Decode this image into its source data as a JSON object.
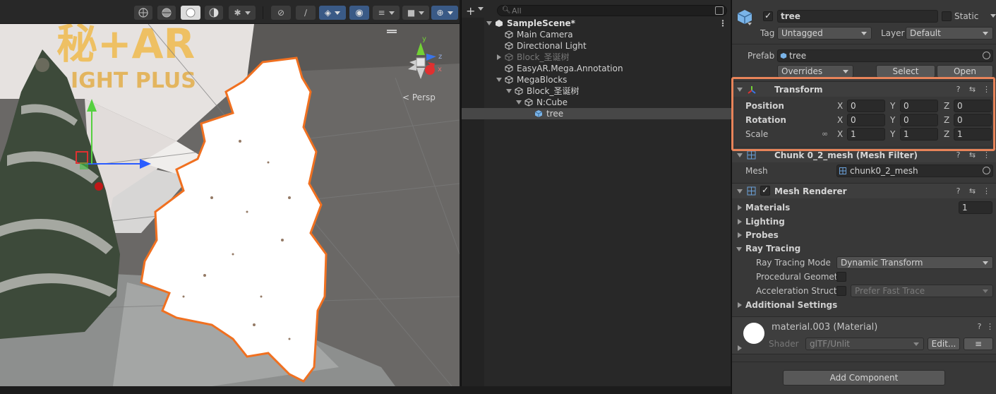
{
  "scene_view": {
    "persp_label": "< Persp",
    "billboard_text_top": "秘+AR",
    "billboard_text_bottom": "IGHT PLUS"
  },
  "hierarchy": {
    "search_placeholder": "All",
    "items": [
      {
        "label": "SampleScene*"
      },
      {
        "label": "Main Camera"
      },
      {
        "label": "Directional Light"
      },
      {
        "label": "Block_圣诞树"
      },
      {
        "label": "EasyAR.Mega.Annotation"
      },
      {
        "label": "MegaBlocks"
      },
      {
        "label": "Block_圣诞树"
      },
      {
        "label": "N:Cube"
      },
      {
        "label": "tree"
      }
    ]
  },
  "inspector": {
    "object_name": "tree",
    "static_label": "Static",
    "tag_label": "Tag",
    "tag_value": "Untagged",
    "layer_label": "Layer",
    "layer_value": "Default",
    "prefab_label": "Prefab",
    "prefab_value": "tree",
    "overrides_label": "Overrides",
    "select_label": "Select",
    "open_label": "Open",
    "transform": {
      "title": "Transform",
      "position_label": "Position",
      "rotation_label": "Rotation",
      "scale_label": "Scale",
      "position": {
        "x": "0",
        "y": "0",
        "z": "0"
      },
      "rotation": {
        "x": "0",
        "y": "0",
        "z": "0"
      },
      "scale": {
        "x": "1",
        "y": "1",
        "z": "1"
      },
      "axis_x": "X",
      "axis_y": "Y",
      "axis_z": "Z"
    },
    "mesh_filter": {
      "title": "Chunk 0_2_mesh (Mesh Filter)",
      "mesh_label": "Mesh",
      "mesh_value": "chunk0_2_mesh"
    },
    "mesh_renderer": {
      "title": "Mesh Renderer",
      "materials_label": "Materials",
      "materials_count": "1",
      "lighting_label": "Lighting",
      "probes_label": "Probes",
      "ray_tracing_label": "Ray Tracing",
      "ray_tracing_mode_label": "Ray Tracing Mode",
      "ray_tracing_mode_value": "Dynamic Transform",
      "procedural_label": "Procedural Geometr",
      "accel_label": "Acceleration Structu",
      "accel_value": "Prefer Fast Trace",
      "additional_label": "Additional Settings"
    },
    "material": {
      "name": "material.003 (Material)",
      "shader_label": "Shader",
      "shader_value": "glTF/Unlit",
      "edit_label": "Edit..."
    },
    "add_component_label": "Add Component"
  },
  "colors": {
    "highlight_border": "#e8845a",
    "selection_outline": "#f07020"
  }
}
